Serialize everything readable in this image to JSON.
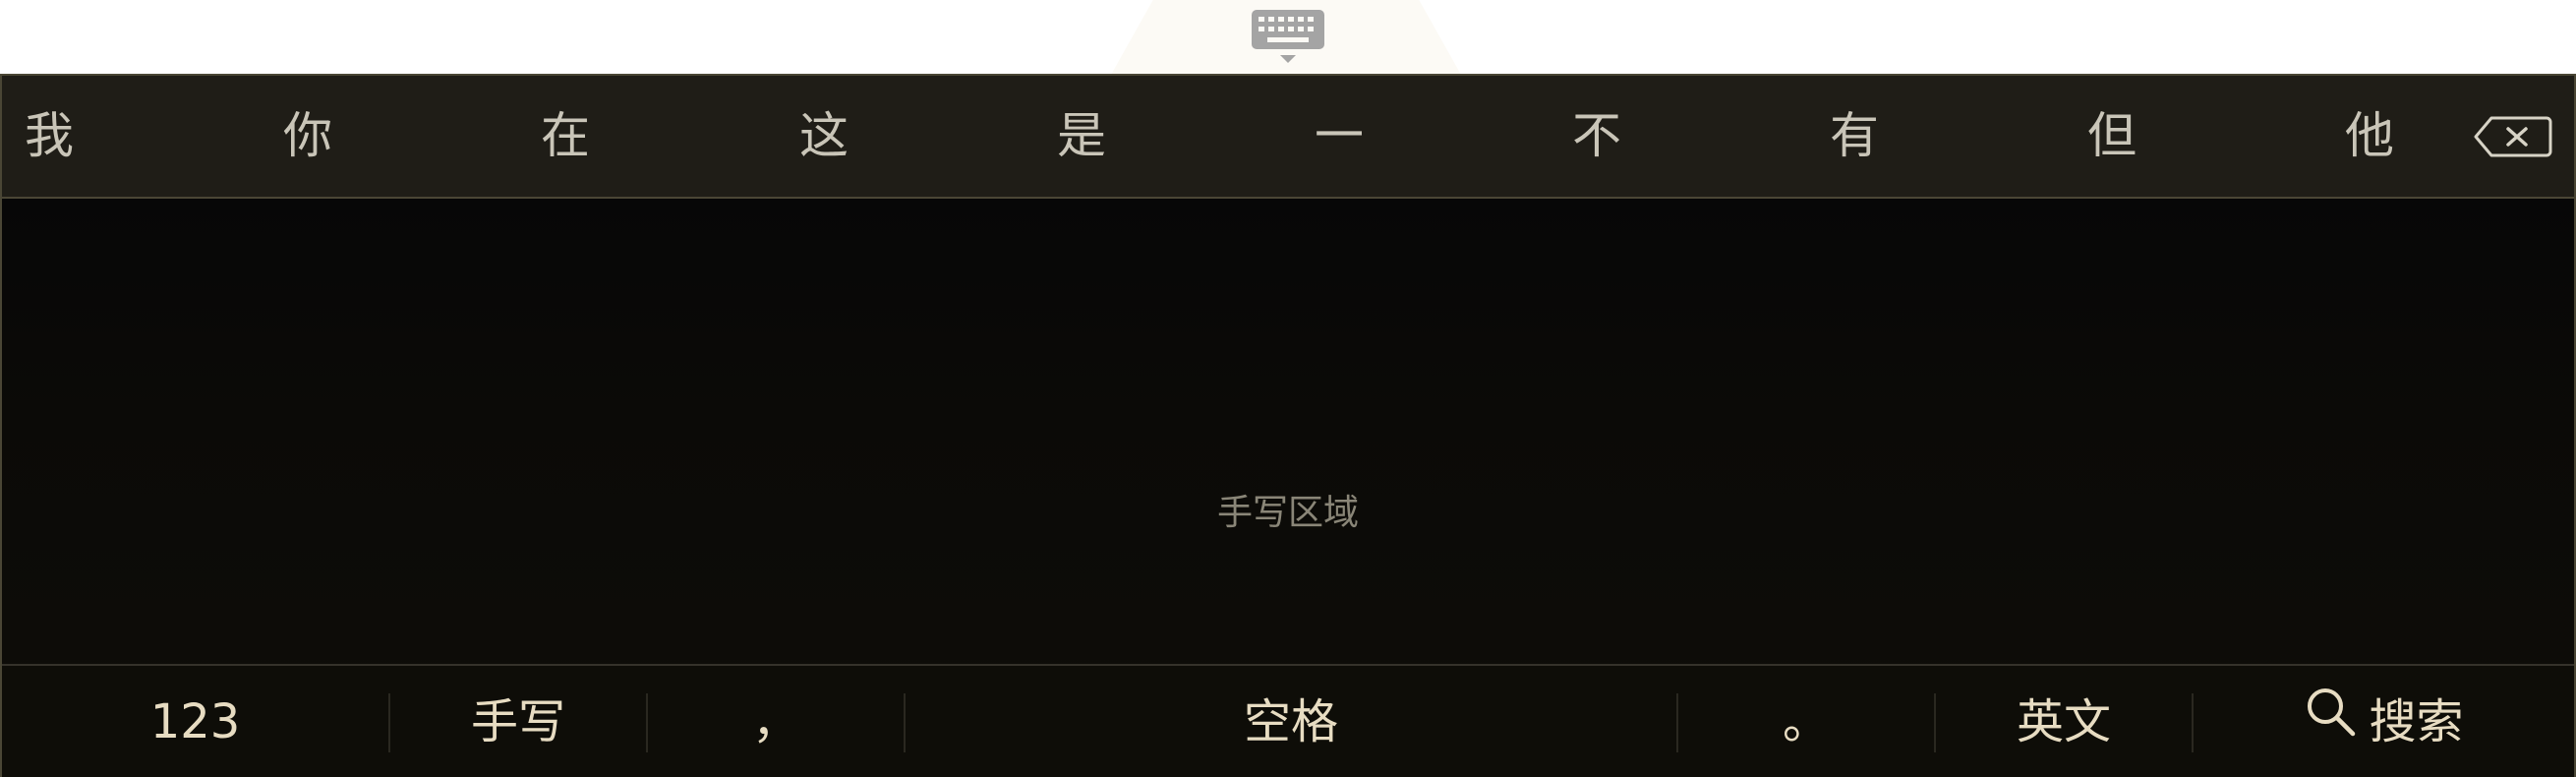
{
  "candidates": [
    "我",
    "你",
    "在",
    "这",
    "是",
    "一",
    "不",
    "有",
    "但",
    "他"
  ],
  "handwriting": {
    "label": "手写区域"
  },
  "keys": {
    "numbers": "123",
    "handwrite": "手写",
    "comma": "，",
    "space": "空格",
    "period": "。",
    "english": "英文",
    "search": "搜索"
  },
  "icons": {
    "keyboard_toggle": "keyboard-hide-icon",
    "backspace": "backspace-icon",
    "search": "search-icon"
  },
  "colors": {
    "background": "#0c0b07",
    "candidate_bar": "#1f1d17",
    "key_text": "#e7dcc2",
    "candidate_text": "#c9c5b8"
  }
}
